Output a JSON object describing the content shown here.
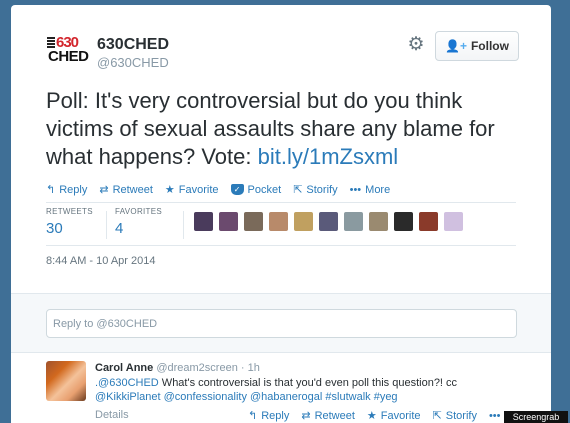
{
  "profile": {
    "logo_text_top": "630",
    "logo_text_bottom": "CHED",
    "name": "630CHED",
    "handle": "@630CHED",
    "follow_label": "Follow"
  },
  "tweet": {
    "text": "Poll: It's very controversial but do you think victims of sexual assaults share any blame for what happens? Vote: ",
    "link": "bit.ly/1mZsxml",
    "actions": [
      {
        "icon": "reply-icon",
        "glyph": "↰",
        "label": "Reply"
      },
      {
        "icon": "retweet-icon",
        "glyph": "⇄",
        "label": "Retweet"
      },
      {
        "icon": "favorite-icon",
        "glyph": "★",
        "label": "Favorite"
      },
      {
        "icon": "pocket-icon",
        "glyph": "✓",
        "label": "Pocket"
      },
      {
        "icon": "storify-icon",
        "glyph": "⇱",
        "label": "Storify"
      },
      {
        "icon": "more-icon",
        "glyph": "•••",
        "label": "More"
      }
    ],
    "retweets_label": "RETWEETS",
    "retweets": "30",
    "favorites_label": "FAVORITES",
    "favorites": "4",
    "timestamp": "8:44 AM - 10 Apr 2014",
    "avatar_colors": [
      "#4a3b5c",
      "#6b4a6e",
      "#7a6a5a",
      "#b88a6a",
      "#c0a060",
      "#5a5a7a",
      "#8a9aa0",
      "#9a8a70",
      "#2a2a2a",
      "#8a3a2a",
      "#d0c0e0"
    ]
  },
  "reply_box": {
    "placeholder": "Reply to @630CHED"
  },
  "reply": {
    "name": "Carol Anne",
    "handle": "@dream2screen",
    "time": "· 1h",
    "mention": ".@630CHED",
    "text": " What's controversial is that you'd even poll this question?! cc",
    "line2": "@KikkiPlanet @confessionality @habanerogal #slutwalk #yeg",
    "details_label": "Details",
    "actions": [
      {
        "icon": "reply-icon",
        "glyph": "↰",
        "label": "Reply"
      },
      {
        "icon": "retweet-icon",
        "glyph": "⇄",
        "label": "Retweet"
      },
      {
        "icon": "favorite-icon",
        "glyph": "★",
        "label": "Favorite"
      },
      {
        "icon": "storify-icon",
        "glyph": "⇱",
        "label": "Storify"
      },
      {
        "icon": "more-icon",
        "glyph": "•••",
        "label": "Mo"
      }
    ]
  },
  "watermark": "Screengrab"
}
